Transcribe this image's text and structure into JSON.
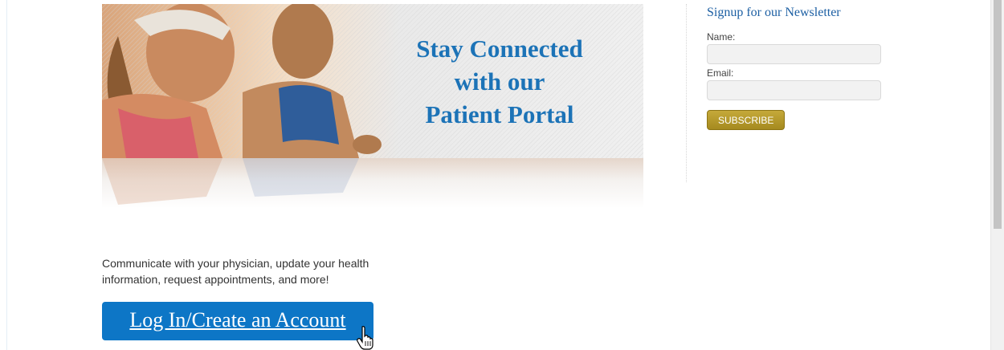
{
  "banner": {
    "title_lines": [
      "Stay Connected",
      "with our",
      "Patient Portal"
    ]
  },
  "newsletter": {
    "heading": "Signup for our Newsletter",
    "name_label": "Name:",
    "name_value": "",
    "email_label": "Email:",
    "email_value": "",
    "subscribe_label": "SUBSCRIBE"
  },
  "main": {
    "description": "Communicate with your physician, update your health information, request appointments, and more!",
    "login_label": "Log In/Create an Account"
  },
  "cursor": {
    "icon": "hand-pointer-icon"
  },
  "colors": {
    "title_blue": "#1c73b7",
    "button_blue": "#0d76c6",
    "subscribe_gold": "#b39a2c"
  }
}
